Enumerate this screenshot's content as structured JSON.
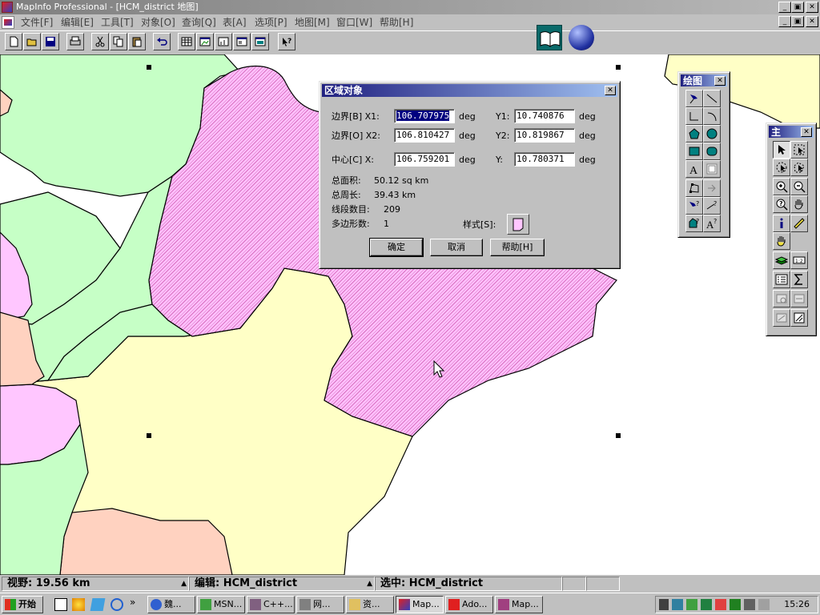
{
  "app": {
    "title": "MapInfo Professional - [HCM_district 地图]",
    "win_min": "_",
    "win_restore": "▣",
    "win_close": "✕"
  },
  "menu": {
    "items": [
      "文件[F]",
      "编辑[E]",
      "工具[T]",
      "对象[O]",
      "查询[Q]",
      "表[A]",
      "选项[P]",
      "地图[M]",
      "窗口[W]",
      "帮助[H]"
    ]
  },
  "colors": {
    "selected_fill": "#ffb3ff",
    "hatch": "#c040a0",
    "green": "#c6ffc6",
    "yellow": "#ffffc6",
    "violet": "#ffc6ff",
    "salmon": "#ffd2c0",
    "dialog_title": "#202080"
  },
  "dialog": {
    "title": "区域对象",
    "close": "✕",
    "rows": [
      {
        "label": "边界[B] X1:",
        "v1": "106.707975",
        "mid": "Y1:",
        "v2": "10.740876",
        "unit": "deg"
      },
      {
        "label": "边界[O] X2:",
        "v1": "106.810427",
        "mid": "Y2:",
        "v2": "10.819867",
        "unit": "deg"
      },
      {
        "label": "中心[C] X:",
        "v1": "106.759201",
        "mid": "Y:",
        "v2": "10.780371",
        "unit": "deg"
      }
    ],
    "stats": [
      {
        "label": "总面积:",
        "value": "50.12 sq km"
      },
      {
        "label": "总周长:",
        "value": "39.43 km"
      },
      {
        "label": "线段数目:",
        "value": "209"
      },
      {
        "label": "多边形数:",
        "value": "1"
      }
    ],
    "style_label": "样式[S]:",
    "ok": "确定",
    "cancel": "取消",
    "help": "帮助[H]"
  },
  "drawing_palette": {
    "title": "绘图",
    "close": "✕"
  },
  "main_palette": {
    "title": "主",
    "close": "✕"
  },
  "status": {
    "zoom": "视野: 19.56 km",
    "editing": "编辑: HCM_district",
    "selection": "选中: HCM_district"
  },
  "taskbar": {
    "start": "开始",
    "more": "»",
    "tasks": [
      "魏...",
      "MSN...",
      "C++...",
      "网...",
      "资...",
      "Map...",
      "Ado...",
      "Map..."
    ],
    "clock": "15:26"
  }
}
